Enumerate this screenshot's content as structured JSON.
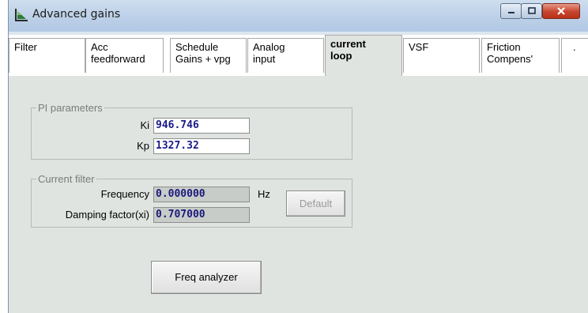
{
  "window": {
    "title": "Advanced gains"
  },
  "tabs": [
    {
      "label": "Filter"
    },
    {
      "label": "Acc\nfeedforward"
    },
    {
      "label": "Schedule\nGains + vpg"
    },
    {
      "label": "Analog\ninput"
    },
    {
      "label": "current\nloop",
      "active": true
    },
    {
      "label": "VSF"
    },
    {
      "label": "Friction\nCompens'"
    },
    {
      "label": "."
    }
  ],
  "pi_parameters": {
    "title": "PI parameters",
    "ki_label": "Ki",
    "ki_value": "946.746",
    "kp_label": "Kp",
    "kp_value": "1327.32"
  },
  "current_filter": {
    "title": "Current filter",
    "frequency_label": "Frequency",
    "frequency_value": "0.000000",
    "frequency_unit": "Hz",
    "damping_label": "Damping factor(xi)",
    "damping_value": "0.707000",
    "default_button": "Default"
  },
  "freq_analyzer_button": "Freq analyzer",
  "colors": {
    "panel_bg": "#dfe4e0",
    "titlebar": "#bcd0e8",
    "value_text": "#1a1a8c"
  }
}
